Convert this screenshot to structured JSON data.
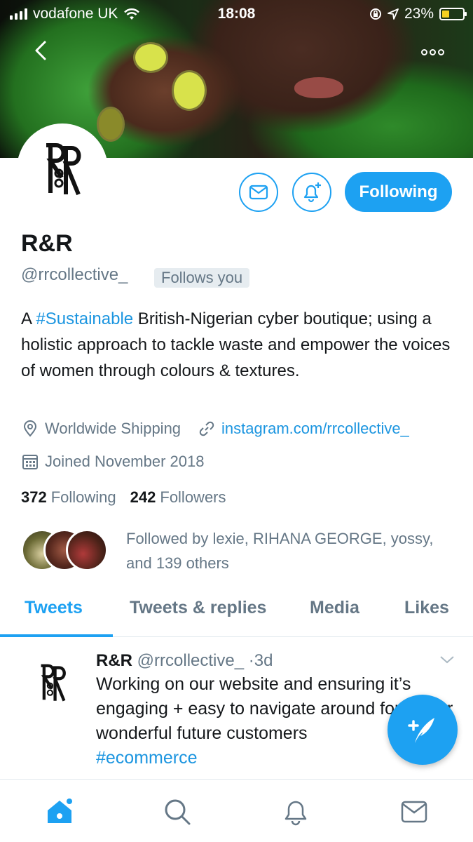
{
  "status_bar": {
    "carrier": "vodafone UK",
    "time": "18:08",
    "battery_percent": "23%",
    "battery_level": 0.23,
    "icons": [
      "signal-icon",
      "wifi-icon",
      "orientation-lock-icon",
      "location-icon",
      "battery-icon"
    ]
  },
  "header": {
    "back_icon": "chevron-left-icon",
    "more_icon": "more-options-icon"
  },
  "profile": {
    "name": "R&R",
    "handle": "@rrcollective_",
    "follows_you_badge": "Follows you",
    "bio_prefix": "A ",
    "bio_hashtag": "#Sustainable",
    "bio_rest": " British-Nigerian cyber boutique; using a holistic approach to tackle waste and empower the voices of women through colours & textures.",
    "location": "Worldwide Shipping",
    "website": "instagram.com/rrcollective_",
    "joined": "Joined November 2018",
    "following_count": "372",
    "following_label": "Following",
    "followers_count": "242",
    "followers_label": "Followers",
    "followed_by_text": "Followed by lexie, RIHANA GEORGE, yossy, and 139 others"
  },
  "actions": {
    "message_icon": "envelope-icon",
    "notify_icon": "bell-plus-icon",
    "follow_button": "Following"
  },
  "tabs": [
    {
      "label": "Tweets",
      "active": true
    },
    {
      "label": "Tweets & replies",
      "active": false
    },
    {
      "label": "Media",
      "active": false
    },
    {
      "label": "Likes",
      "active": false
    }
  ],
  "tweet": {
    "author": "R&R",
    "handle": "@rrcollective_",
    "separator": "·",
    "time": "3d",
    "text": "Working on our website and ensuring it’s engaging + easy to navigate around for all our wonderful future customers",
    "hashtag": "#ecommerce"
  },
  "fab": {
    "icon": "compose-tweet-icon"
  },
  "bottom_nav": [
    "home-icon",
    "search-icon",
    "notifications-icon",
    "messages-icon"
  ],
  "colors": {
    "accent": "#1da1f2",
    "link": "#1b95e0",
    "secondary_text": "#657786",
    "primary_text": "#14171a"
  }
}
